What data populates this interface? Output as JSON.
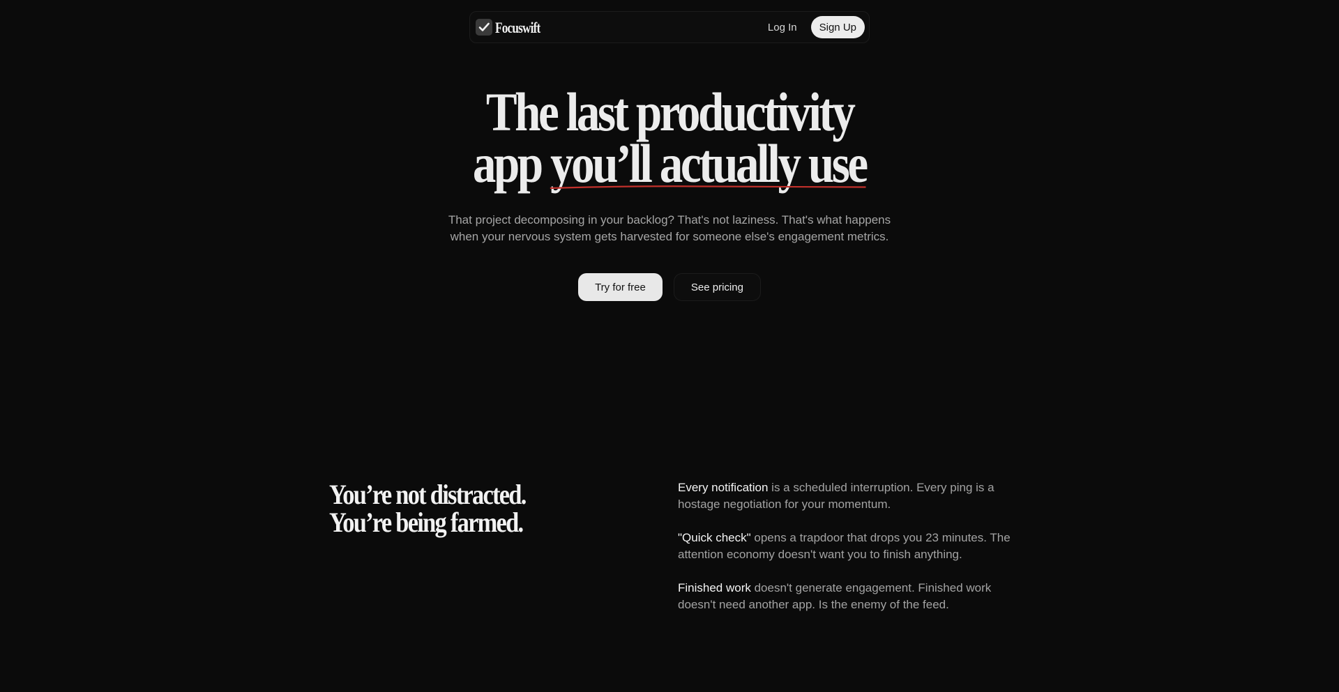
{
  "nav": {
    "brand": "Focuswift",
    "brand_icon": "check-square-icon",
    "login_label": "Log In",
    "signup_label": "Sign Up"
  },
  "hero": {
    "title_line1": "The last productivity",
    "title_line2_start": "app",
    "title_line2_underlined": "you’ll actually use",
    "subtitle_line1": "That project decomposing in your backlog? That's not laziness. That's what happens",
    "subtitle_line2": "when your nervous system gets harvested for someone else's engagement metrics.",
    "primary_cta": "Try for free",
    "secondary_cta": "See pricing",
    "underline_color": "#c0302b"
  },
  "section": {
    "heading_line1": "You’re not distracted.",
    "heading_line2": "You’re being farmed.",
    "points": [
      {
        "lead": "Every notification",
        "text": " is a scheduled interruption. Every ping is a hostage negotiation for your momentum."
      },
      {
        "lead": "\"Quick check\"",
        "text": " opens a trapdoor that drops you 23 minutes. The attention economy doesn't want you to finish anything."
      },
      {
        "lead": "Finished work",
        "text": " doesn't generate engagement. Finished work doesn't need another app. Is the enemy of the feed."
      }
    ]
  },
  "colors": {
    "background": "#0b0b0b",
    "text_primary": "#ececec",
    "text_muted": "#a6a6a6",
    "accent_underline": "#c0302b"
  }
}
